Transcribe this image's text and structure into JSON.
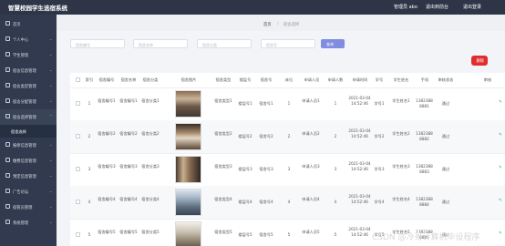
{
  "header": {
    "brand": "智慧校园学生选宿系统",
    "user": "管理员 abo",
    "links": [
      "退出到前台",
      "退出登录"
    ]
  },
  "sidebar": {
    "items": [
      {
        "label": "首页"
      },
      {
        "label": "个人中心"
      },
      {
        "label": "学生管理"
      },
      {
        "label": "宿舍信息管理"
      },
      {
        "label": "宿舍类型管理"
      },
      {
        "label": "宿舍分配管理"
      },
      {
        "label": "宿舍选择管理"
      },
      {
        "label": "报修信息管理"
      },
      {
        "label": "缴费信息管理"
      },
      {
        "label": "预定信息管理"
      },
      {
        "label": "广告论坛"
      },
      {
        "label": "宿管员管理"
      },
      {
        "label": "系统管理"
      }
    ],
    "active_sub": "宿舍选择"
  },
  "breadcrumb": {
    "home": "首页",
    "sep": "/",
    "current": "宿舍选择"
  },
  "filters": {
    "placeholders": [
      "宿舍编号",
      "宿舍名称",
      "宿舍分类",
      "宿舍号"
    ],
    "query_label": "查询",
    "delete_label": "删除"
  },
  "table": {
    "columns": [
      "索引",
      "宿舍编号",
      "宿舍名称",
      "宿舍分类",
      "宿舍图片",
      "宿舍类型",
      "楼层号",
      "宿舍号",
      "床位",
      "申请人员",
      "申请人数",
      "申请时间",
      "学号",
      "学生姓名",
      "手机",
      "审核状态",
      "审核"
    ],
    "rows": [
      {
        "idx": "1",
        "code": "宿舍编号1",
        "name": "宿舍编号1",
        "cat": "宿舍分类1",
        "type": "宿舍类型1",
        "floor": "楼层号1",
        "room": "宿舍号1",
        "bed": "1",
        "applicant": "申请人员1",
        "count": "1",
        "time": "2021-03-04 14:52:46",
        "sid": "学号1",
        "sname": "学生姓名1",
        "phone": "13823888881",
        "status": "通过"
      },
      {
        "idx": "2",
        "code": "宿舍编号2",
        "name": "宿舍编号2",
        "cat": "宿舍分类2",
        "type": "宿舍类型2",
        "floor": "楼层号2",
        "room": "宿舍号2",
        "bed": "2",
        "applicant": "申请人员2",
        "count": "2",
        "time": "2021-03-04 14:52:46",
        "sid": "学号2",
        "sname": "学生姓名2",
        "phone": "13823888882",
        "status": "通过"
      },
      {
        "idx": "3",
        "code": "宿舍编号3",
        "name": "宿舍编号3",
        "cat": "宿舍分类3",
        "type": "宿舍类型3",
        "floor": "楼层号3",
        "room": "宿舍号3",
        "bed": "3",
        "applicant": "申请人员3",
        "count": "3",
        "time": "2021-03-04 14:52:46",
        "sid": "学号3",
        "sname": "学生姓名3",
        "phone": "13823888883",
        "status": "通过"
      },
      {
        "idx": "4",
        "code": "宿舍编号4",
        "name": "宿舍编号4",
        "cat": "宿舍分类4",
        "type": "宿舍类型4",
        "floor": "楼层号4",
        "room": "宿舍号4",
        "bed": "4",
        "applicant": "申请人员4",
        "count": "4",
        "time": "2021-03-04 14:52:46",
        "sid": "学号4",
        "sname": "学生姓名4",
        "phone": "13823888884",
        "status": "通过"
      },
      {
        "idx": "5",
        "code": "宿舍编号5",
        "name": "宿舍编号5",
        "cat": "宿舍分类5",
        "type": "宿舍类型5",
        "floor": "楼层号5",
        "room": "宿舍号5",
        "bed": "5",
        "applicant": "申请人员5",
        "count": "5",
        "time": "2021-03-04 14:52:46",
        "sid": "学号5",
        "sname": "学生姓名5",
        "phone": "13823888885",
        "status": "通过"
      }
    ]
  },
  "watermark": "CSDN @冷哥计算机毕设程序",
  "colors": {
    "topbar": "#2d3547",
    "sidebar": "#313a4e",
    "accent": "#7f8ce0",
    "danger": "#e02c2c",
    "success": "#1db36a"
  }
}
